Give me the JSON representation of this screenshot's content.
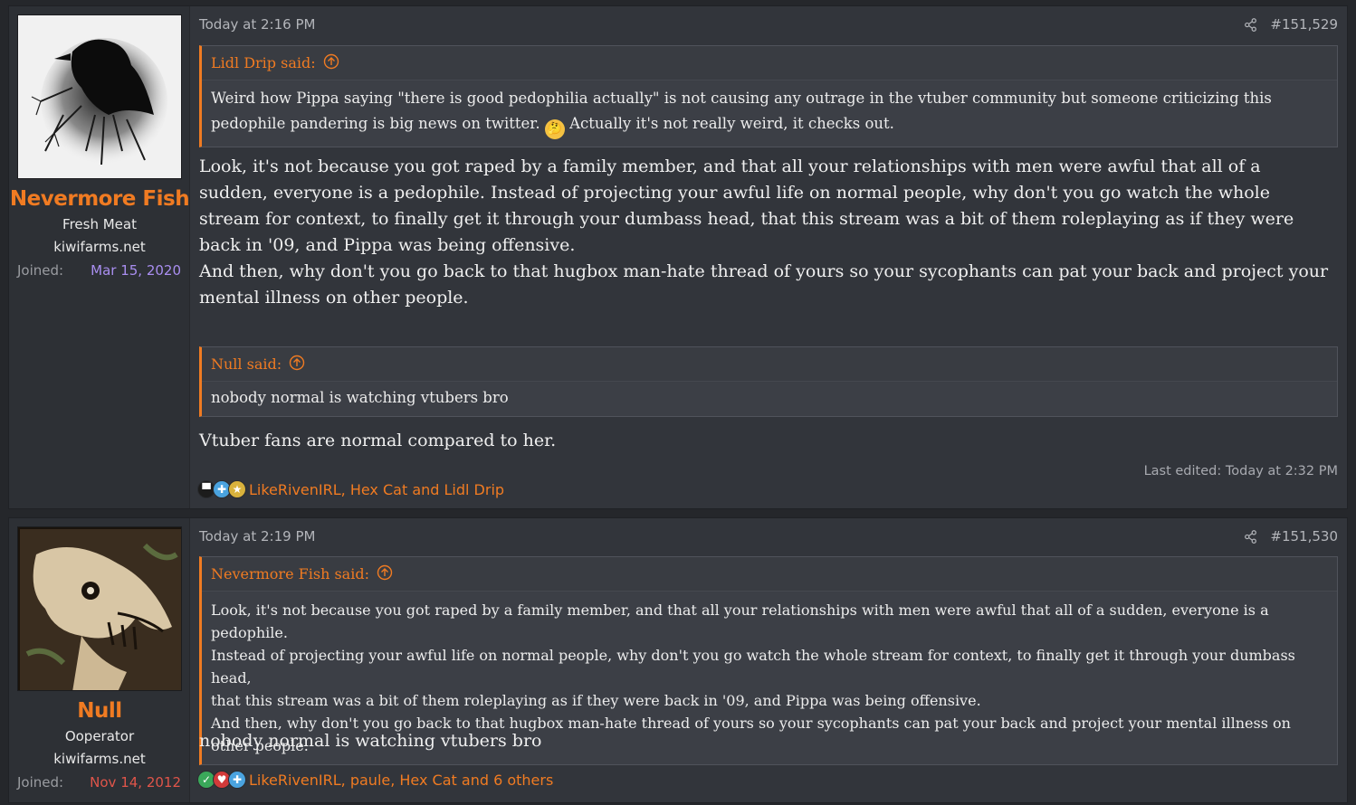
{
  "posts": [
    {
      "user": {
        "name": "Nevermore Fish",
        "title": "Fresh Meat",
        "banner": "kiwifarms.net",
        "joined_label": "Joined:",
        "joined_date": "Mar 15, 2020",
        "joined_color": "#a98ef0",
        "avatar_icon": "crow-avatar"
      },
      "timestamp": "Today at 2:16 PM",
      "post_number": "#151,529",
      "quotes": [
        {
          "author": "Lidl Drip said:",
          "text_a": "Weird how Pippa saying \"there is good pedophilia actually\" is not causing any outrage in the vtuber community but someone criticizing this pedophile pandering is big news on twitter.",
          "emoji": "thinking-face-emoji",
          "text_b": "Actually it's not really weird, it checks out."
        },
        {
          "author": "Null said:",
          "text": "nobody normal is watching vtubers bro"
        }
      ],
      "body": [
        "Look, it's not because you got raped by a family member, and that all your relationships with men were awful that all of a sudden, everyone is a pedophile. Instead of projecting your awful life on normal people, why don't you go watch the whole stream for context, to finally get it through your dumbass head, that this stream was a bit of them roleplaying as if they were back in '09, and Pippa was being offensive.",
        "And then, why don't you go back to that hugbox man-hate thread of yours so your sycophants can pat your back and project your mental illness on other people.",
        "Vtuber fans are normal compared to her."
      ],
      "last_edited": "Last edited: Today at 2:32 PM",
      "reactions_text": "LikeRivenIRL, Hex Cat and Lidl Drip",
      "reaction_icons": [
        "top-hat-icon",
        "puzzle-piece-icon",
        "medal-icon"
      ]
    },
    {
      "user": {
        "name": "Null",
        "title": "Ooperator",
        "banner": "kiwifarms.net",
        "joined_label": "Joined:",
        "joined_date": "Nov 14, 2012",
        "joined_color": "#e0554a",
        "avatar_icon": "creature-avatar"
      },
      "timestamp": "Today at 2:19 PM",
      "post_number": "#151,530",
      "quotes": [
        {
          "author": "Nevermore Fish said:",
          "lines": [
            "Look, it's not because you got raped by a family member, and that all your relationships with men were awful that all of a sudden, everyone is a pedophile.",
            "Instead of projecting your awful life on normal people, why don't you go watch the whole stream for context, to finally get it through your dumbass head,",
            "that this stream was a bit of them roleplaying as if they were back in '09, and Pippa was being offensive.",
            "And then, why don't you go back to that hugbox man-hate thread of yours so your sycophants can pat your back and project your mental illness on other people."
          ]
        }
      ],
      "body": [
        "nobody normal is watching vtubers bro"
      ],
      "reactions_text": "LikeRivenIRL, paule, Hex Cat and 6 others",
      "reaction_icons": [
        "checkmark-icon",
        "heart-icon",
        "puzzle-piece-icon"
      ]
    }
  ],
  "colors": {
    "accent": "#f07b22",
    "post_bg": "#32353b",
    "user_bg": "#2d3035",
    "quote_bg": "#3c3f46"
  }
}
